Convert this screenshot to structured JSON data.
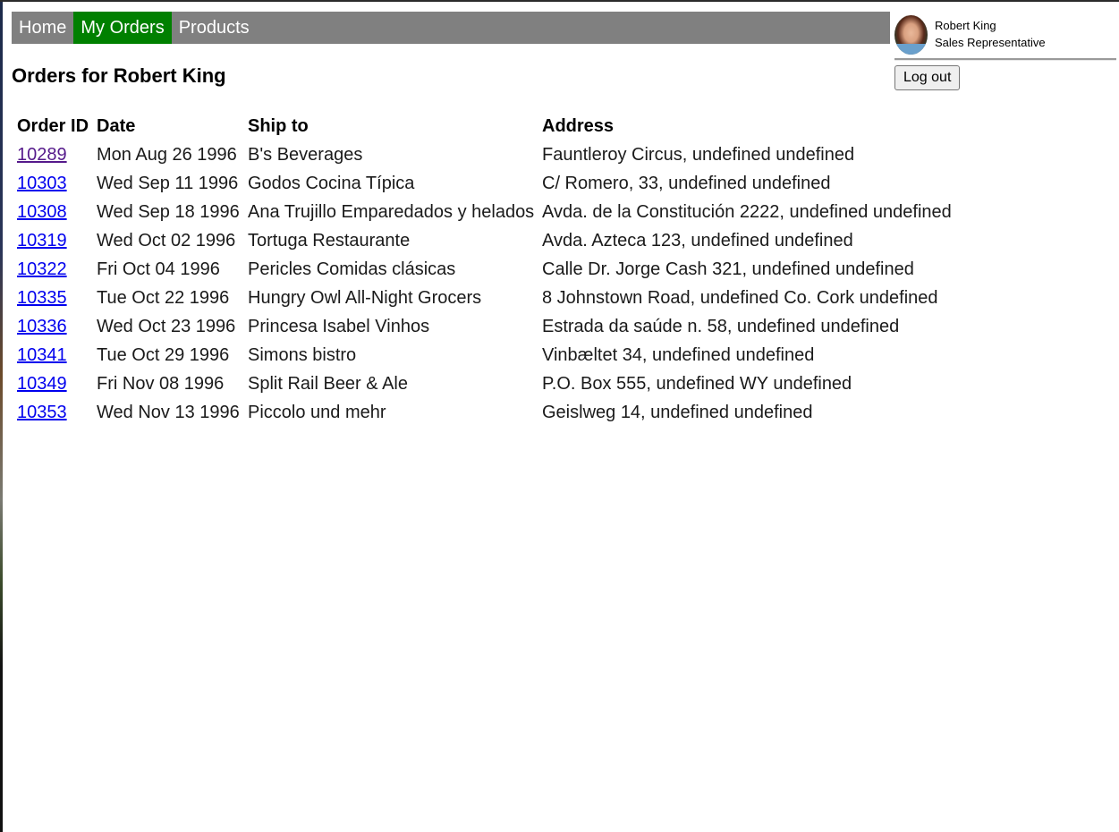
{
  "nav": {
    "items": [
      {
        "label": "Home",
        "active": false
      },
      {
        "label": "My Orders",
        "active": true
      },
      {
        "label": "Products",
        "active": false
      }
    ],
    "active_color": "#008000",
    "bar_color": "#808080"
  },
  "user": {
    "name": "Robert King",
    "role": "Sales Representative",
    "avatar_icon": "user-photo",
    "logout_label": "Log out"
  },
  "page": {
    "title": "Orders for Robert King"
  },
  "orders": {
    "columns": [
      "Order ID",
      "Date",
      "Ship to",
      "Address"
    ],
    "rows": [
      {
        "id": "10289",
        "date": "Mon Aug 26 1996",
        "ship_to": "B's Beverages",
        "address": "Fauntleroy Circus, undefined undefined",
        "visited": true
      },
      {
        "id": "10303",
        "date": "Wed Sep 11 1996",
        "ship_to": "Godos Cocina Típica",
        "address": "C/ Romero, 33, undefined undefined",
        "visited": false
      },
      {
        "id": "10308",
        "date": "Wed Sep 18 1996",
        "ship_to": "Ana Trujillo Emparedados y helados",
        "address": "Avda. de la Constitución 2222, undefined undefined",
        "visited": false
      },
      {
        "id": "10319",
        "date": "Wed Oct 02 1996",
        "ship_to": "Tortuga Restaurante",
        "address": "Avda. Azteca 123, undefined undefined",
        "visited": false
      },
      {
        "id": "10322",
        "date": "Fri Oct 04 1996",
        "ship_to": "Pericles Comidas clásicas",
        "address": "Calle Dr. Jorge Cash 321, undefined undefined",
        "visited": false
      },
      {
        "id": "10335",
        "date": "Tue Oct 22 1996",
        "ship_to": "Hungry Owl All-Night Grocers",
        "address": "8 Johnstown Road, undefined Co. Cork undefined",
        "visited": false
      },
      {
        "id": "10336",
        "date": "Wed Oct 23 1996",
        "ship_to": "Princesa Isabel Vinhos",
        "address": "Estrada da saúde n. 58, undefined undefined",
        "visited": false
      },
      {
        "id": "10341",
        "date": "Tue Oct 29 1996",
        "ship_to": "Simons bistro",
        "address": "Vinbæltet 34, undefined undefined",
        "visited": false
      },
      {
        "id": "10349",
        "date": "Fri Nov 08 1996",
        "ship_to": "Split Rail Beer & Ale",
        "address": "P.O. Box 555, undefined WY undefined",
        "visited": false
      },
      {
        "id": "10353",
        "date": "Wed Nov 13 1996",
        "ship_to": "Piccolo und mehr",
        "address": "Geislweg 14, undefined undefined",
        "visited": false
      }
    ],
    "link_color": "#0000ee",
    "visited_link_color": "#551a8b"
  }
}
